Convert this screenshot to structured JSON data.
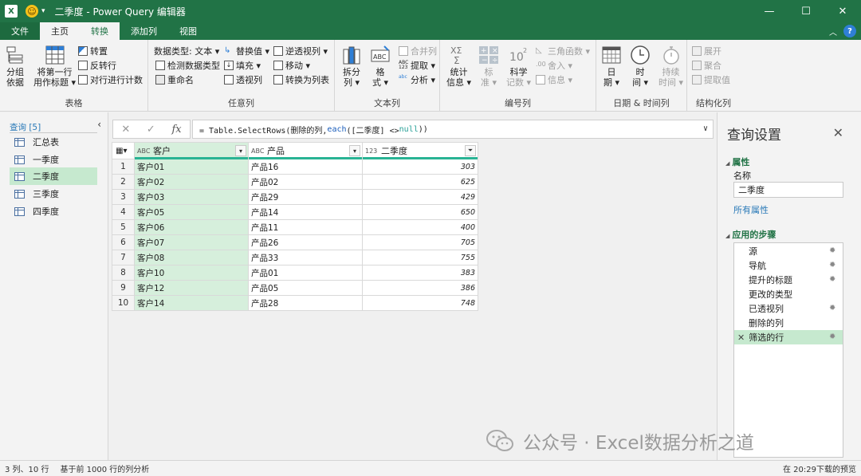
{
  "window": {
    "app_icon_text": "X",
    "title": "二季度 - Power Query 编辑器",
    "controls": [
      "—",
      "☐",
      "✕"
    ]
  },
  "tabs": [
    "文件",
    "主页",
    "转换",
    "添加列",
    "视图"
  ],
  "ribbon": {
    "groups": {
      "table": "表格",
      "any_column": "任意列",
      "text_column": "文本列",
      "number_column": "编号列",
      "datetime_column": "日期 & 时间列",
      "structured_column": "结构化列"
    },
    "table": {
      "group_by": [
        "分组",
        "依据"
      ],
      "first_row_header": [
        "将第一行",
        "用作标题 ▾"
      ],
      "transpose": "转置",
      "reverse_rows": "反转行",
      "count_rows": "对行进行计数"
    },
    "any": {
      "data_type": "数据类型: 文本 ▾",
      "detect_type": "检测数据类型",
      "rename": "重命名",
      "replace_values": "替换值 ▾",
      "fill": "填充 ▾",
      "pivot_column": "透视列",
      "unpivot": "逆透视列 ▾",
      "move": "移动 ▾",
      "convert_to_list": "转换为列表"
    },
    "text": {
      "split": [
        "拆分",
        "列 ▾"
      ],
      "format": [
        "格",
        "式 ▾"
      ],
      "merge": "合并列",
      "extract": "提取 ▾",
      "parse": "分析 ▾"
    },
    "number": {
      "stats": [
        "统计",
        "信息 ▾"
      ],
      "standard": [
        "标",
        "准 ▾"
      ],
      "scientific": [
        "科学",
        "记数 ▾"
      ],
      "trig": "三角函数 ▾",
      "round": "舍入 ▾",
      "info": "信息 ▾"
    },
    "datetime": {
      "date": [
        "日",
        "期 ▾"
      ],
      "time": [
        "时",
        "间 ▾"
      ],
      "duration": [
        "持续",
        "时间 ▾"
      ]
    },
    "structured": {
      "expand": "展开",
      "aggregate": "聚合",
      "extract_values": "提取值"
    }
  },
  "nav": {
    "header": "查询 [5]",
    "items": [
      "汇总表",
      "一季度",
      "二季度",
      "三季度",
      "四季度"
    ],
    "selected": 2
  },
  "formula": {
    "prefix": "= Table.SelectRows(删除的列, ",
    "keyword": "each",
    "mid": " ([二季度] <> ",
    "null": "null",
    "suffix": "))"
  },
  "grid": {
    "columns": [
      {
        "type": "ABC",
        "name": "客户"
      },
      {
        "type": "ABC",
        "name": "产品"
      },
      {
        "type": "123",
        "name": "二季度"
      }
    ],
    "rows": [
      [
        "1",
        "客户01",
        "产品16",
        "303"
      ],
      [
        "2",
        "客户02",
        "产品02",
        "625"
      ],
      [
        "3",
        "客户03",
        "产品29",
        "429"
      ],
      [
        "4",
        "客户05",
        "产品14",
        "650"
      ],
      [
        "5",
        "客户06",
        "产品11",
        "400"
      ],
      [
        "6",
        "客户07",
        "产品26",
        "705"
      ],
      [
        "7",
        "客户08",
        "产品33",
        "755"
      ],
      [
        "8",
        "客户10",
        "产品01",
        "383"
      ],
      [
        "9",
        "客户12",
        "产品05",
        "386"
      ],
      [
        "10",
        "客户14",
        "产品28",
        "748"
      ]
    ]
  },
  "settings": {
    "title": "查询设置",
    "properties": "属性",
    "name_label": "名称",
    "name_value": "二季度",
    "all_properties": "所有属性",
    "applied_steps": "应用的步骤",
    "steps": [
      {
        "label": "源",
        "gear": true
      },
      {
        "label": "导航",
        "gear": true
      },
      {
        "label": "提升的标题",
        "gear": true
      },
      {
        "label": "更改的类型",
        "gear": false
      },
      {
        "label": "已透视列",
        "gear": true
      },
      {
        "label": "删除的列",
        "gear": false
      },
      {
        "label": "筛选的行",
        "gear": true
      }
    ],
    "selected_step": 6
  },
  "watermark": "公众号 · Excel数据分析之道",
  "status": {
    "left": "3 列、10 行",
    "profile": "基于前 1000 行的列分析",
    "right": "在 20:29下载的预览"
  },
  "colors": {
    "brand": "#217346",
    "selected": "#c6e9cf",
    "link": "#2a7ab8",
    "quality_bar": "#29b394"
  }
}
